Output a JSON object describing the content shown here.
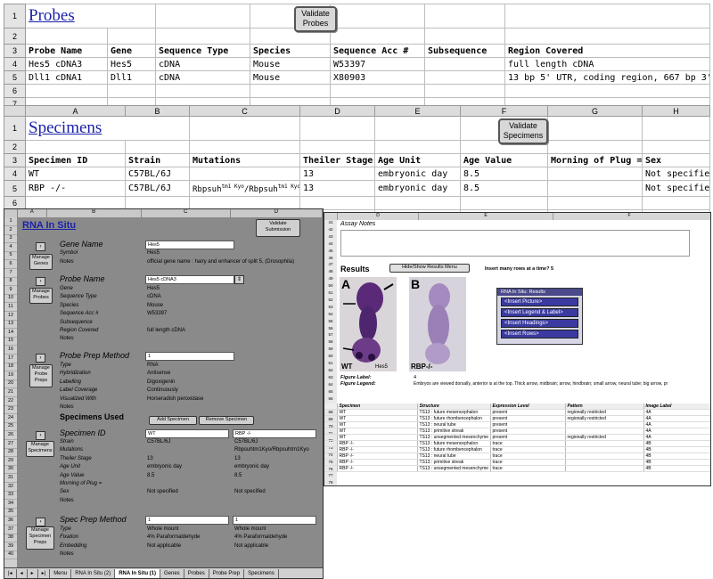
{
  "probes": {
    "title": "Probes",
    "validate_button": "Validate Probes",
    "row_numbers": [
      "1",
      "2",
      "3",
      "4",
      "5",
      "6",
      "7"
    ],
    "headers": [
      "Probe Name",
      "Gene",
      "Sequence Type",
      "Species",
      "Sequence Acc #",
      "Subsequence",
      "Region Covered"
    ],
    "rows": [
      [
        "Hes5 cDNA3",
        "Hes5",
        "cDNA",
        "Mouse",
        "W53397",
        "",
        "full length cDNA"
      ],
      [
        "Dll1 cDNA1",
        "Dll1",
        "cDNA",
        "Mouse",
        "X80903",
        "",
        "13 bp 5' UTR, coding region, 667 bp 3'UTR"
      ]
    ]
  },
  "specimens": {
    "title": "Specimens",
    "validate_button": "Validate Specimens",
    "col_letters": [
      "A",
      "B",
      "C",
      "D",
      "E",
      "F",
      "G",
      "H"
    ],
    "row_numbers": [
      "1",
      "2",
      "3",
      "4",
      "5",
      "6",
      "7"
    ],
    "headers": [
      "Specimen ID",
      "Strain",
      "Mutations",
      "Theiler Stage",
      "Age Unit",
      "Age Value",
      "Morning of Plug =",
      "Sex"
    ],
    "rows": [
      [
        "WT",
        "C57BL/6J",
        "",
        "13",
        "embryonic day",
        "8.5",
        "",
        "Not specified"
      ],
      [
        "RBP -/-",
        "C57BL/6J",
        "Rbpsuh",
        "13",
        "embryonic day",
        "8.5",
        "",
        "Not specified"
      ]
    ],
    "mutation_sup": "tm1 Kyo",
    "mutation_sep": "/Rbpsuh"
  },
  "insitu": {
    "title": "RNA In Situ",
    "validate_button": "Validate Submission",
    "col_letters": [
      "A",
      "B",
      "C",
      "D"
    ],
    "row_numbers": [
      "1",
      "2",
      "3",
      "4",
      "5",
      "6",
      "7",
      "8",
      "9",
      "10",
      "11",
      "12",
      "13",
      "14",
      "15",
      "16",
      "17",
      "18",
      "19",
      "20",
      "21",
      "22",
      "23",
      "24",
      "25",
      "26",
      "27",
      "28",
      "29",
      "30",
      "31",
      "32",
      "33",
      "34",
      "35",
      "36",
      "37",
      "38",
      "39",
      "40"
    ],
    "gene": {
      "section": "Gene Name",
      "value": "Hes5",
      "symbol_label": "Symbol",
      "symbol": "Hes5",
      "notes_label": "Notes",
      "notes": "official gene name : hairy and enhancer of split 5, (Drosophila)",
      "button": "Manage Genes"
    },
    "probe": {
      "section": "Probe Name",
      "value": "Hes5 cDNA3",
      "button": "Manage Probes",
      "fields": [
        [
          "Gene",
          "Hes5"
        ],
        [
          "Sequence Type",
          "cDNA"
        ],
        [
          "Species",
          "Mouse"
        ],
        [
          "Sequence Acc #",
          "W53397"
        ],
        [
          "Subsequence",
          ""
        ],
        [
          "Region Covered",
          "full length cDNA"
        ],
        [
          "Notes",
          ""
        ]
      ]
    },
    "prep": {
      "section": "Probe Prep Method",
      "value": "1",
      "button": "Manage Probe Preps",
      "fields": [
        [
          "Type",
          "RNA"
        ],
        [
          "Hybridization",
          "Antisense"
        ],
        [
          "Labelling",
          "Digoxigenin"
        ],
        [
          "Label Coverage",
          "Continuously"
        ],
        [
          "Visualized With",
          "Horseradish peroxidase"
        ],
        [
          "Notes",
          ""
        ]
      ]
    },
    "specimens_used": "Specimens Used",
    "add_specimen": "Add Specimen",
    "remove_specimen": "Remove Specimen",
    "specimen": {
      "section": "Specimen ID",
      "button": "Manage Specimens",
      "ids": [
        "WT",
        "RBP -/-"
      ],
      "fields": [
        [
          "Strain",
          "C57BL/6J",
          "C57BL/6J"
        ],
        [
          "Mutations",
          "",
          "Rbpsuhtm1Kyo/Rbpsuhtm1Kyo"
        ],
        [
          "Theiler Stage",
          "13",
          "13"
        ],
        [
          "Age Unit",
          "embryonic day",
          "embryonic day"
        ],
        [
          "Age Value",
          "8.5",
          "8.5"
        ],
        [
          "Morning of Plug =",
          "",
          ""
        ],
        [
          "Sex",
          "Not specified",
          "Not specified"
        ],
        [
          "Notes",
          "",
          ""
        ]
      ]
    },
    "spec_prep": {
      "section": "Spec Prep Method",
      "values": [
        "1",
        "1"
      ],
      "button": "Manage Specimen Preps",
      "fields": [
        [
          "Type",
          "Whole mount",
          "Whole mount"
        ],
        [
          "Fixation",
          "4% Paraformaldehyde",
          "4% Paraformaldehyde"
        ],
        [
          "Embedding",
          "Not applicable",
          "Not applicable"
        ],
        [
          "Notes",
          "",
          ""
        ]
      ]
    },
    "tabs": [
      "Menu",
      "RNA In Situ (2)",
      "RNA In Situ (1)",
      "Genes",
      "Probes",
      "Probe Prep",
      "Specimens"
    ]
  },
  "results": {
    "col_letters": [
      "D",
      "E",
      "F"
    ],
    "assay_notes_label": "Assay Notes",
    "results_label": "Results",
    "hide_show_button": "Hide/Show Results Menu",
    "insert_rows_text": "Insert many rows at a time? 5",
    "panel_title": "RNA In Situ: Results",
    "panel_buttons": [
      "<Insert Picture>",
      "<Insert Legend & Label>",
      "<Insert Headings>",
      "<Insert Rows>"
    ],
    "figure_label_label": "Figure Label:",
    "figure_label": "4",
    "figure_legend_label": "Figure Legend:",
    "figure_legend": "Embryos are viewed dorsally, anterior is at the top. Thick arrow, midbrain; arrow, hindbrain; small arrow, neural tube; big arrow, pr",
    "image_letters": [
      "A",
      "B"
    ],
    "image_captions": [
      "WT",
      "Hes5",
      "RBP-/-"
    ],
    "row_numbers": [
      "41",
      "42",
      "43",
      "44",
      "45",
      "46",
      "47",
      "48",
      "49",
      "50",
      "51",
      "52",
      "53",
      "54",
      "55",
      "56",
      "57",
      "58",
      "59",
      "60",
      "61",
      "62",
      "63",
      "64",
      "65",
      "66",
      "67",
      "68",
      "69",
      "70",
      "71",
      "72",
      "73",
      "74",
      "75",
      "76",
      "77",
      "78"
    ],
    "table_headers": [
      "Specimen",
      "Structure",
      "Expression Level",
      "Pattern",
      "Image Label"
    ],
    "table_rows": [
      [
        "WT",
        "TS13 : future mesencephalon",
        "present",
        "regionally restricted",
        "4A"
      ],
      [
        "WT",
        "TS13 : future rhombencephalon",
        "present",
        "regionally restricted",
        "4A"
      ],
      [
        "WT",
        "TS13 : neural tube",
        "present",
        "",
        "4A"
      ],
      [
        "WT",
        "TS13 : primitive streak",
        "present",
        "",
        "4A"
      ],
      [
        "WT",
        "TS13 : unsegmented mesenchyme",
        "present",
        "regionally restricted",
        "4A"
      ],
      [
        "RBP -/-",
        "TS13 : future mesencephalon",
        "trace",
        "",
        "4B"
      ],
      [
        "RBP -/-",
        "TS13 : future rhombencephalon",
        "trace",
        "",
        "4B"
      ],
      [
        "RBP -/-",
        "TS13 : neural tube",
        "trace",
        "",
        "4B"
      ],
      [
        "RBP -/-",
        "TS13 : primitive streak",
        "trace",
        "",
        "4B"
      ],
      [
        "RBP -/-",
        "TS13 : unsegmented mesenchyme",
        "trace",
        "",
        "4B"
      ]
    ]
  },
  "colors": {
    "link": "#1a22a8",
    "panel_bg": "#8a8a8a",
    "stain": "#5a2a78"
  }
}
